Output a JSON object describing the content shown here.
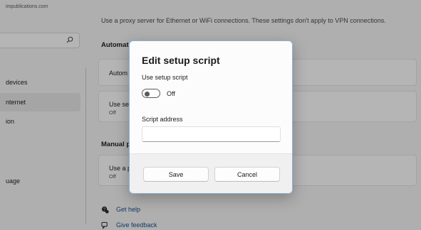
{
  "account": {
    "email": "impublications.com"
  },
  "nav": {
    "search_placeholder": "",
    "items": [
      {
        "label": "devices"
      },
      {
        "label": "nternet"
      },
      {
        "label": "ion"
      },
      {
        "label": "uage"
      }
    ]
  },
  "main": {
    "description": "Use a proxy server for Ethernet or WiFi connections. These settings don't apply to VPN connections.",
    "auto_section_title": "Automat",
    "auto_detect_card_title": "Autom",
    "setup_script_card": {
      "title": "Use se",
      "status": "Off"
    },
    "manual_section_title": "Manual p",
    "manual_card": {
      "title": "Use a p",
      "status": "Off"
    },
    "links": {
      "get_help": "Get help",
      "give_feedback": "Give feedback"
    }
  },
  "dialog": {
    "title": "Edit setup script",
    "use_setup_script_label": "Use setup script",
    "toggle_state": "Off",
    "script_address_label": "Script address",
    "script_address_value": "",
    "save_label": "Save",
    "cancel_label": "Cancel"
  },
  "colors": {
    "accent": "#1a4f8a",
    "dialog_border": "#8fb2d6"
  }
}
